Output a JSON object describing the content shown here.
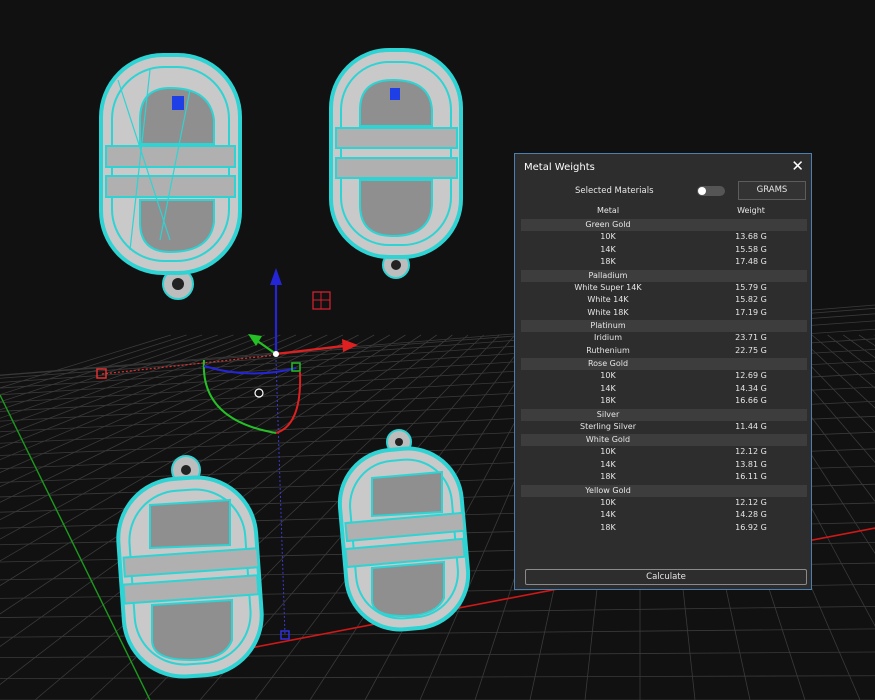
{
  "viewport": {
    "background": "#111111",
    "grid_color": "#3c3c3c",
    "model_color": "#2ed3d3",
    "model_fill": "#c4c4c4",
    "axis_colors": {
      "x": "#e02020",
      "y": "#2dbd2d",
      "z": "#2020e0"
    }
  },
  "panel": {
    "title": "Metal Weights",
    "close_icon": "close-icon",
    "selected_materials_label": "Selected Materials",
    "selected_materials_toggle": "off",
    "unit_button": "GRAMS",
    "columns": {
      "metal": "Metal",
      "weight": "Weight"
    },
    "groups": [
      {
        "name": "Green Gold",
        "items": [
          {
            "metal": "10K",
            "weight": "13.68 G"
          },
          {
            "metal": "14K",
            "weight": "15.58 G"
          },
          {
            "metal": "18K",
            "weight": "17.48 G"
          }
        ]
      },
      {
        "name": "Palladium",
        "items": [
          {
            "metal": "White Super 14K",
            "weight": "15.79 G"
          },
          {
            "metal": "White 14K",
            "weight": "15.82 G"
          },
          {
            "metal": "White 18K",
            "weight": "17.19 G"
          }
        ]
      },
      {
        "name": "Platinum",
        "items": [
          {
            "metal": "Iridium",
            "weight": "23.71 G"
          },
          {
            "metal": "Ruthenium",
            "weight": "22.75 G"
          }
        ]
      },
      {
        "name": "Rose Gold",
        "items": [
          {
            "metal": "10K",
            "weight": "12.69 G"
          },
          {
            "metal": "14K",
            "weight": "14.34 G"
          },
          {
            "metal": "18K",
            "weight": "16.66 G"
          }
        ]
      },
      {
        "name": "Silver",
        "items": [
          {
            "metal": "Sterling Silver",
            "weight": "11.44 G"
          }
        ]
      },
      {
        "name": "White Gold",
        "items": [
          {
            "metal": "10K",
            "weight": "12.12 G"
          },
          {
            "metal": "14K",
            "weight": "13.81 G"
          },
          {
            "metal": "18K",
            "weight": "16.11 G"
          }
        ]
      },
      {
        "name": "Yellow Gold",
        "items": [
          {
            "metal": "10K",
            "weight": "12.12 G"
          },
          {
            "metal": "14K",
            "weight": "14.28 G"
          },
          {
            "metal": "18K",
            "weight": "16.92 G"
          }
        ]
      }
    ],
    "calculate_button": "Calculate"
  }
}
